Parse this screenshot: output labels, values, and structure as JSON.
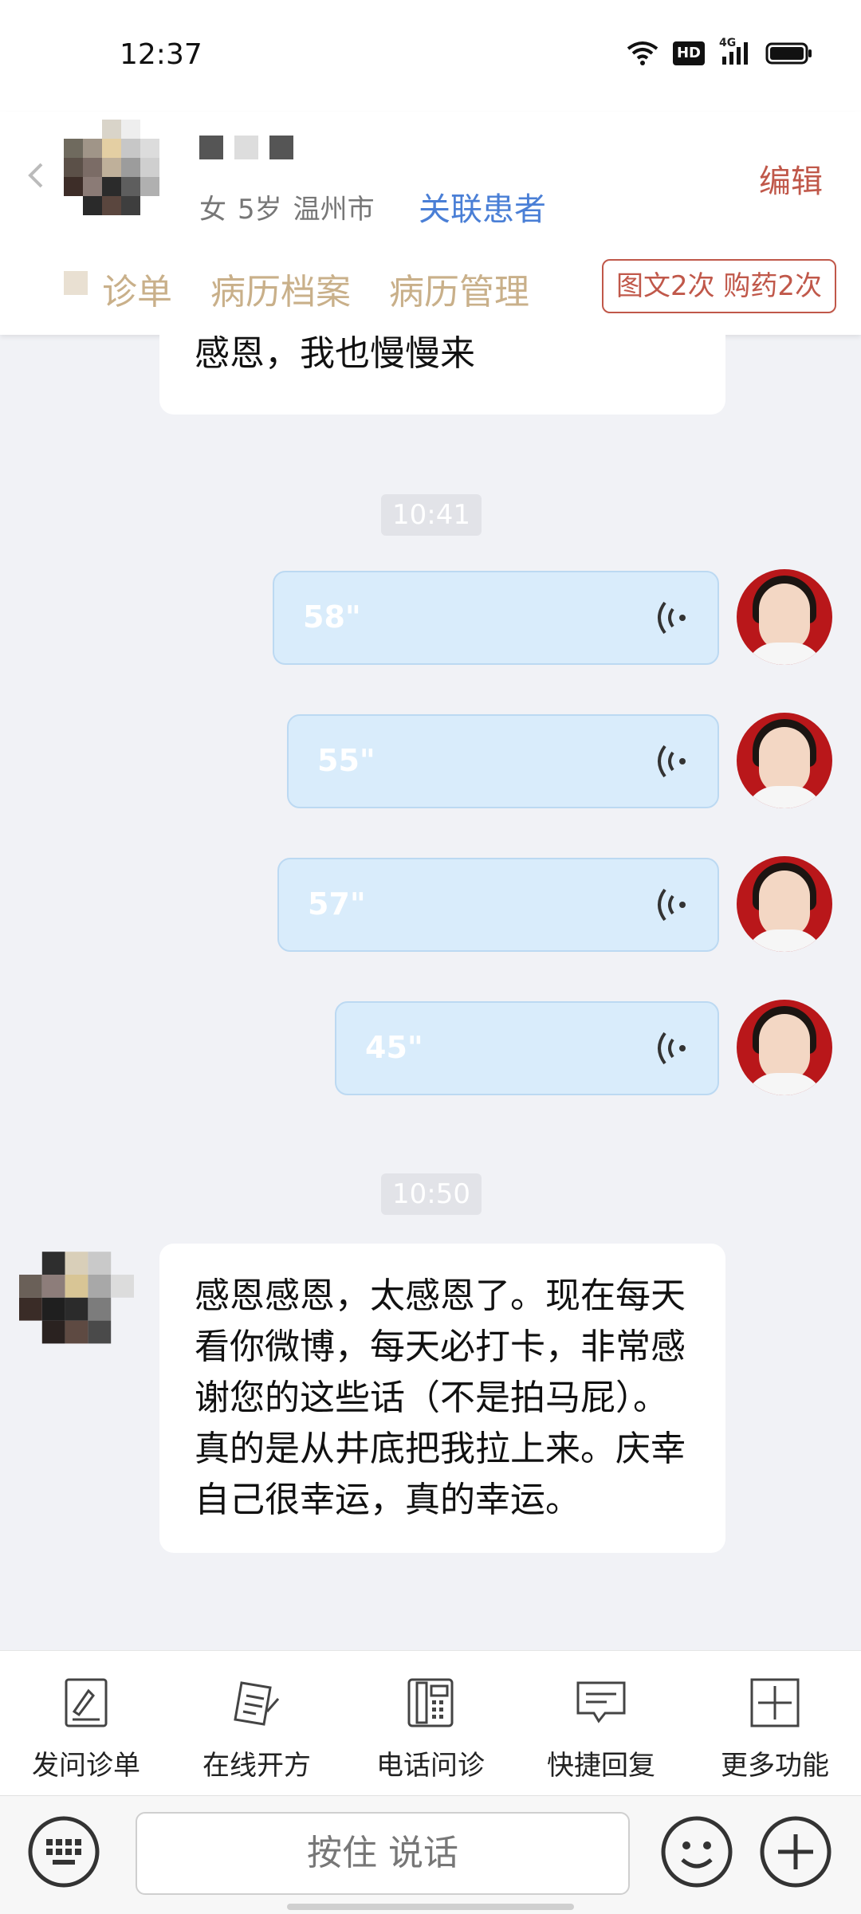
{
  "status_bar": {
    "time": "12:37",
    "network_badge": "HD",
    "network_gen": "4G"
  },
  "header": {
    "patient_gender": "女",
    "patient_age": "5岁",
    "patient_city": "温州市",
    "link_patient_label": "关联患者",
    "edit_label": "编辑",
    "tabs": [
      "诊单",
      "病历档案",
      "病历管理"
    ],
    "stats_badge": "图文2次 购药2次"
  },
  "chat": {
    "prev_message_tail": "感恩，我也慢慢来",
    "time1": "10:41",
    "voice_messages": [
      {
        "duration": "58\""
      },
      {
        "duration": "55\""
      },
      {
        "duration": "57\""
      },
      {
        "duration": "45\""
      }
    ],
    "time2": "10:50",
    "patient_message": "感恩感恩，太感恩了。现在每天看你微博，每天必打卡，非常感谢您的这些话（不是拍马屁）。真的是从井底把我拉上来。庆幸自己很幸运，真的幸运。"
  },
  "tools": [
    {
      "label": "发问诊单",
      "icon": "form-icon"
    },
    {
      "label": "在线开方",
      "icon": "prescription-icon"
    },
    {
      "label": "电话问诊",
      "icon": "phone-icon"
    },
    {
      "label": "快捷回复",
      "icon": "quick-reply-icon"
    },
    {
      "label": "更多功能",
      "icon": "more-icon"
    }
  ],
  "input": {
    "hold_to_talk": "按住 说话"
  },
  "colors": {
    "accent_red": "#c0584a",
    "link_blue": "#4a7fd6",
    "tab_gold": "#c9b08a",
    "voice_bubble": "#d9ecfb"
  }
}
